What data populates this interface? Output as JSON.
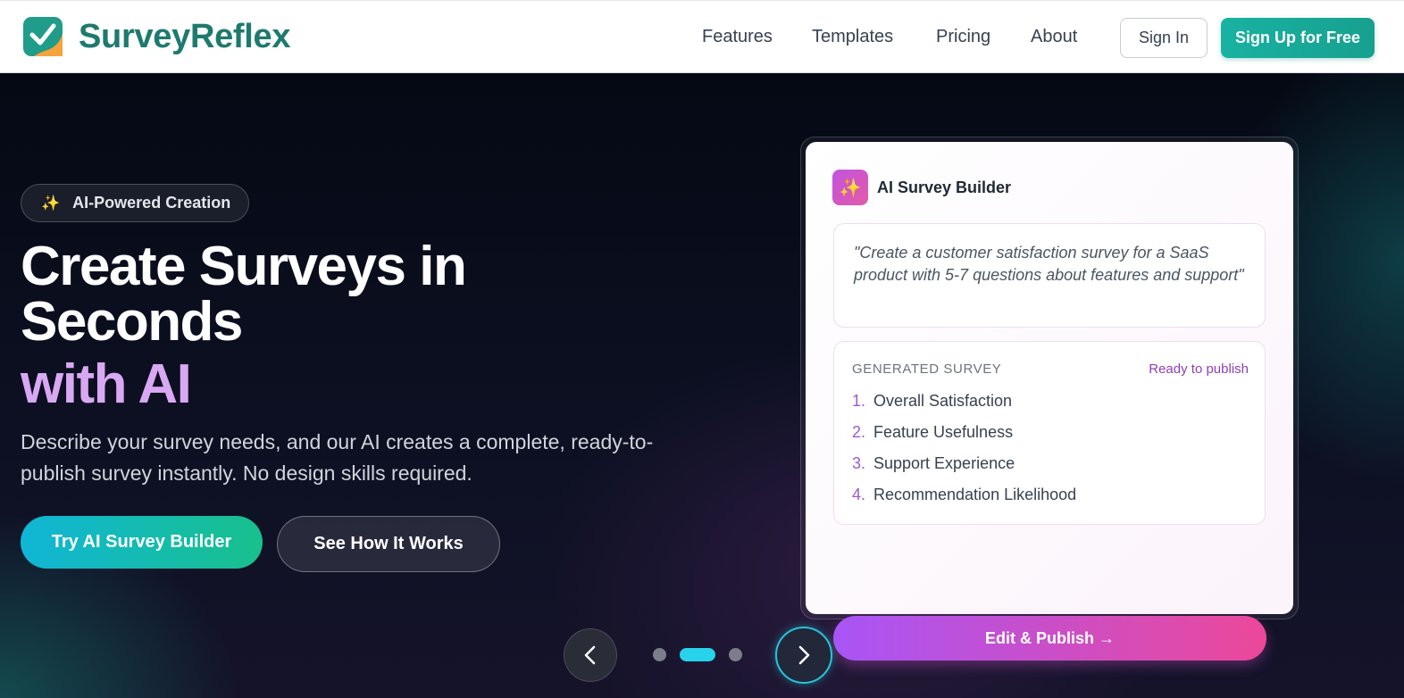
{
  "header": {
    "brand": "SurveyReflex",
    "nav": [
      {
        "label": "Features"
      },
      {
        "label": "Templates"
      },
      {
        "label": "Pricing"
      },
      {
        "label": "About"
      }
    ],
    "sign_in": "Sign In",
    "sign_up": "Sign Up for Free"
  },
  "hero": {
    "badge": "AI-Powered Creation",
    "headline_line1": "Create Surveys in",
    "headline_line2": "Seconds",
    "headline_accent": "with AI",
    "subtext": "Describe your survey needs, and our AI creates a complete, ready-to-publish survey instantly. No design skills required.",
    "cta_primary": "Try AI Survey Builder",
    "cta_secondary": "See How It Works"
  },
  "card": {
    "title": "AI Survey Builder",
    "prompt": "\"Create a customer satisfaction survey for a SaaS product with 5-7 questions about features and support\"",
    "generated_label": "GENERATED SURVEY",
    "status": "Ready to publish",
    "questions": [
      {
        "num": "1.",
        "text": "Overall Satisfaction"
      },
      {
        "num": "2.",
        "text": "Feature Usefulness"
      },
      {
        "num": "3.",
        "text": "Support Experience"
      },
      {
        "num": "4.",
        "text": "Recommendation Likelihood"
      }
    ],
    "publish_button": "Edit & Publish →"
  },
  "carousel": {
    "slide_count": 3,
    "active_index": 1
  },
  "colors": {
    "brand": "#1e7a6e",
    "signup": "#19b2a2",
    "accent_purple": "#d9a8f2",
    "active_dot": "#27d3ea"
  },
  "icons": {
    "logo": "checkmark-logo-icon",
    "badge": "sparkles-icon",
    "card": "sparkles-icon",
    "prev": "chevron-left-icon",
    "next": "chevron-right-icon"
  }
}
